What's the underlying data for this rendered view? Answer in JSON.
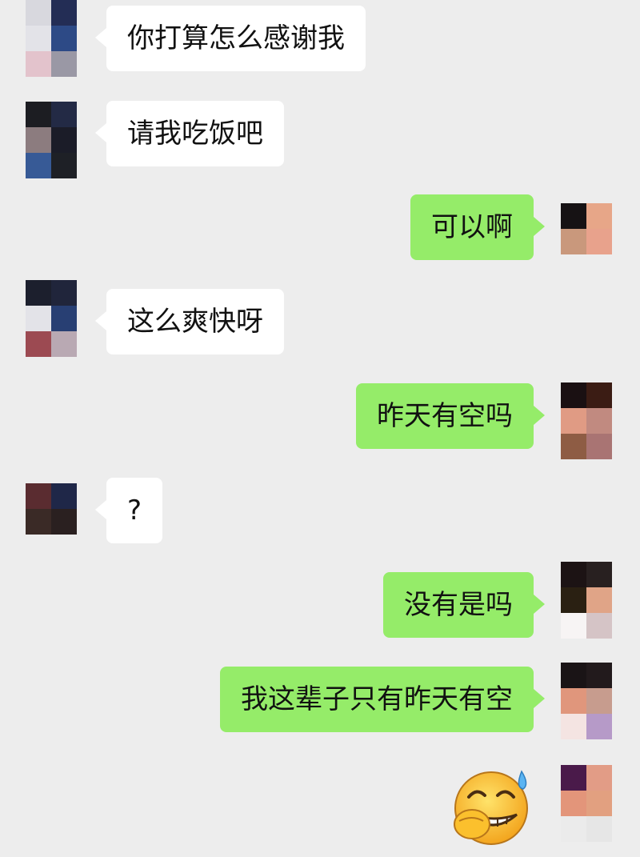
{
  "messages": [
    {
      "side": "left",
      "text": "你打算怎么感谢我"
    },
    {
      "side": "left",
      "text": "请我吃饭吧"
    },
    {
      "side": "right",
      "text": "可以啊"
    },
    {
      "side": "left",
      "text": "这么爽快呀"
    },
    {
      "side": "right",
      "text": "昨天有空吗"
    },
    {
      "side": "left",
      "text": "?"
    },
    {
      "side": "right",
      "text": "没有是吗"
    },
    {
      "side": "right",
      "text": "我这辈子只有昨天有空"
    },
    {
      "side": "right",
      "sticker": "grinning-sweat-face-covering-mouth-emoji"
    }
  ],
  "avatars": {
    "other": [
      "#1e2234",
      "#232d55",
      "#e3e3e8",
      "#2d4a86",
      "#e3c3cc",
      "#9a98a5"
    ],
    "me": [
      "#1a1012",
      "#3b1c14",
      "#e09b84",
      "#c18a80",
      "#8e5c44",
      "#a97473"
    ]
  }
}
